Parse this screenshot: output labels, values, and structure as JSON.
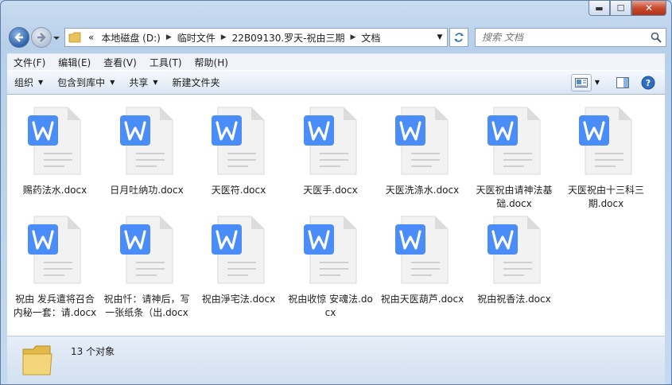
{
  "address": {
    "overflow_label": "«",
    "crumbs": [
      "本地磁盘 (D:)",
      "临时文件",
      "22B09130.罗天-祝由三期",
      "文档"
    ]
  },
  "search": {
    "placeholder": "搜索 文档"
  },
  "menu": [
    "文件(F)",
    "编辑(E)",
    "查看(V)",
    "工具(T)",
    "帮助(H)"
  ],
  "toolbar": {
    "organize": "组织",
    "include_library": "包含到库中",
    "share": "共享",
    "new_folder": "新建文件夹"
  },
  "files": [
    "赐药法水.docx",
    "日月吐纳功.docx",
    "天医符.docx",
    "天医手.docx",
    "天医洗涤水.docx",
    "天医祝由请神法基础.docx",
    "天医祝由十三科三期.docx",
    "祝由 发兵遣将召合内秘一套：请.docx",
    "祝由忏：请神后，写一张纸条（出.docx",
    "祝由淨宅法.docx",
    "祝由收惊 安魂法.docx",
    "祝由天医葫芦.docx",
    "祝由祝香法.docx"
  ],
  "status": {
    "count_text": "13 个对象"
  },
  "colors": {
    "wps_blue": "#4a8df8",
    "page_gray": "#f2f2f2"
  }
}
